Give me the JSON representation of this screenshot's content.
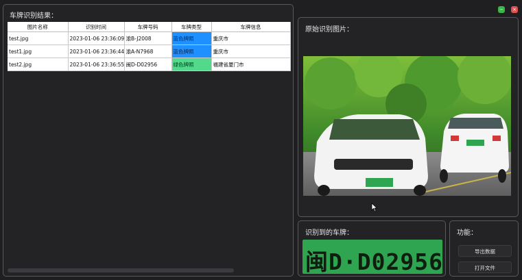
{
  "results": {
    "title": "车牌识别结果：",
    "columns": [
      "图片名称",
      "识别时间",
      "车牌号码",
      "车牌类型",
      "车牌信息"
    ],
    "rows": [
      {
        "name": "test.jpg",
        "time": "2023-01-06 23:36:09",
        "plate": "渝B-J2008",
        "type": "蓝色牌照",
        "info": "重庆市"
      },
      {
        "name": "test1.jpg",
        "time": "2023-01-06 23:36:44",
        "plate": "渝A-N7968",
        "type": "蓝色牌照",
        "info": "重庆市"
      },
      {
        "name": "test2.jpg",
        "time": "2023-01-06 23:36:55",
        "plate": "闽D-D02956",
        "type": "绿色牌照",
        "info": "福建省厦门市"
      }
    ]
  },
  "window": {
    "minimize": "−",
    "close": "×"
  },
  "image_panel": {
    "title": "原始识别图片："
  },
  "plate_panel": {
    "title": "识别到的车牌：",
    "plate_text": "闽D·D02956"
  },
  "func_panel": {
    "title": "功能：",
    "export_label": "导出数据",
    "open_label": "打开文件"
  },
  "colors": {
    "blue_plate": "#1e90ff",
    "green_plate": "#52d98b",
    "close": "#e05050",
    "minimize": "#3bb54a"
  }
}
